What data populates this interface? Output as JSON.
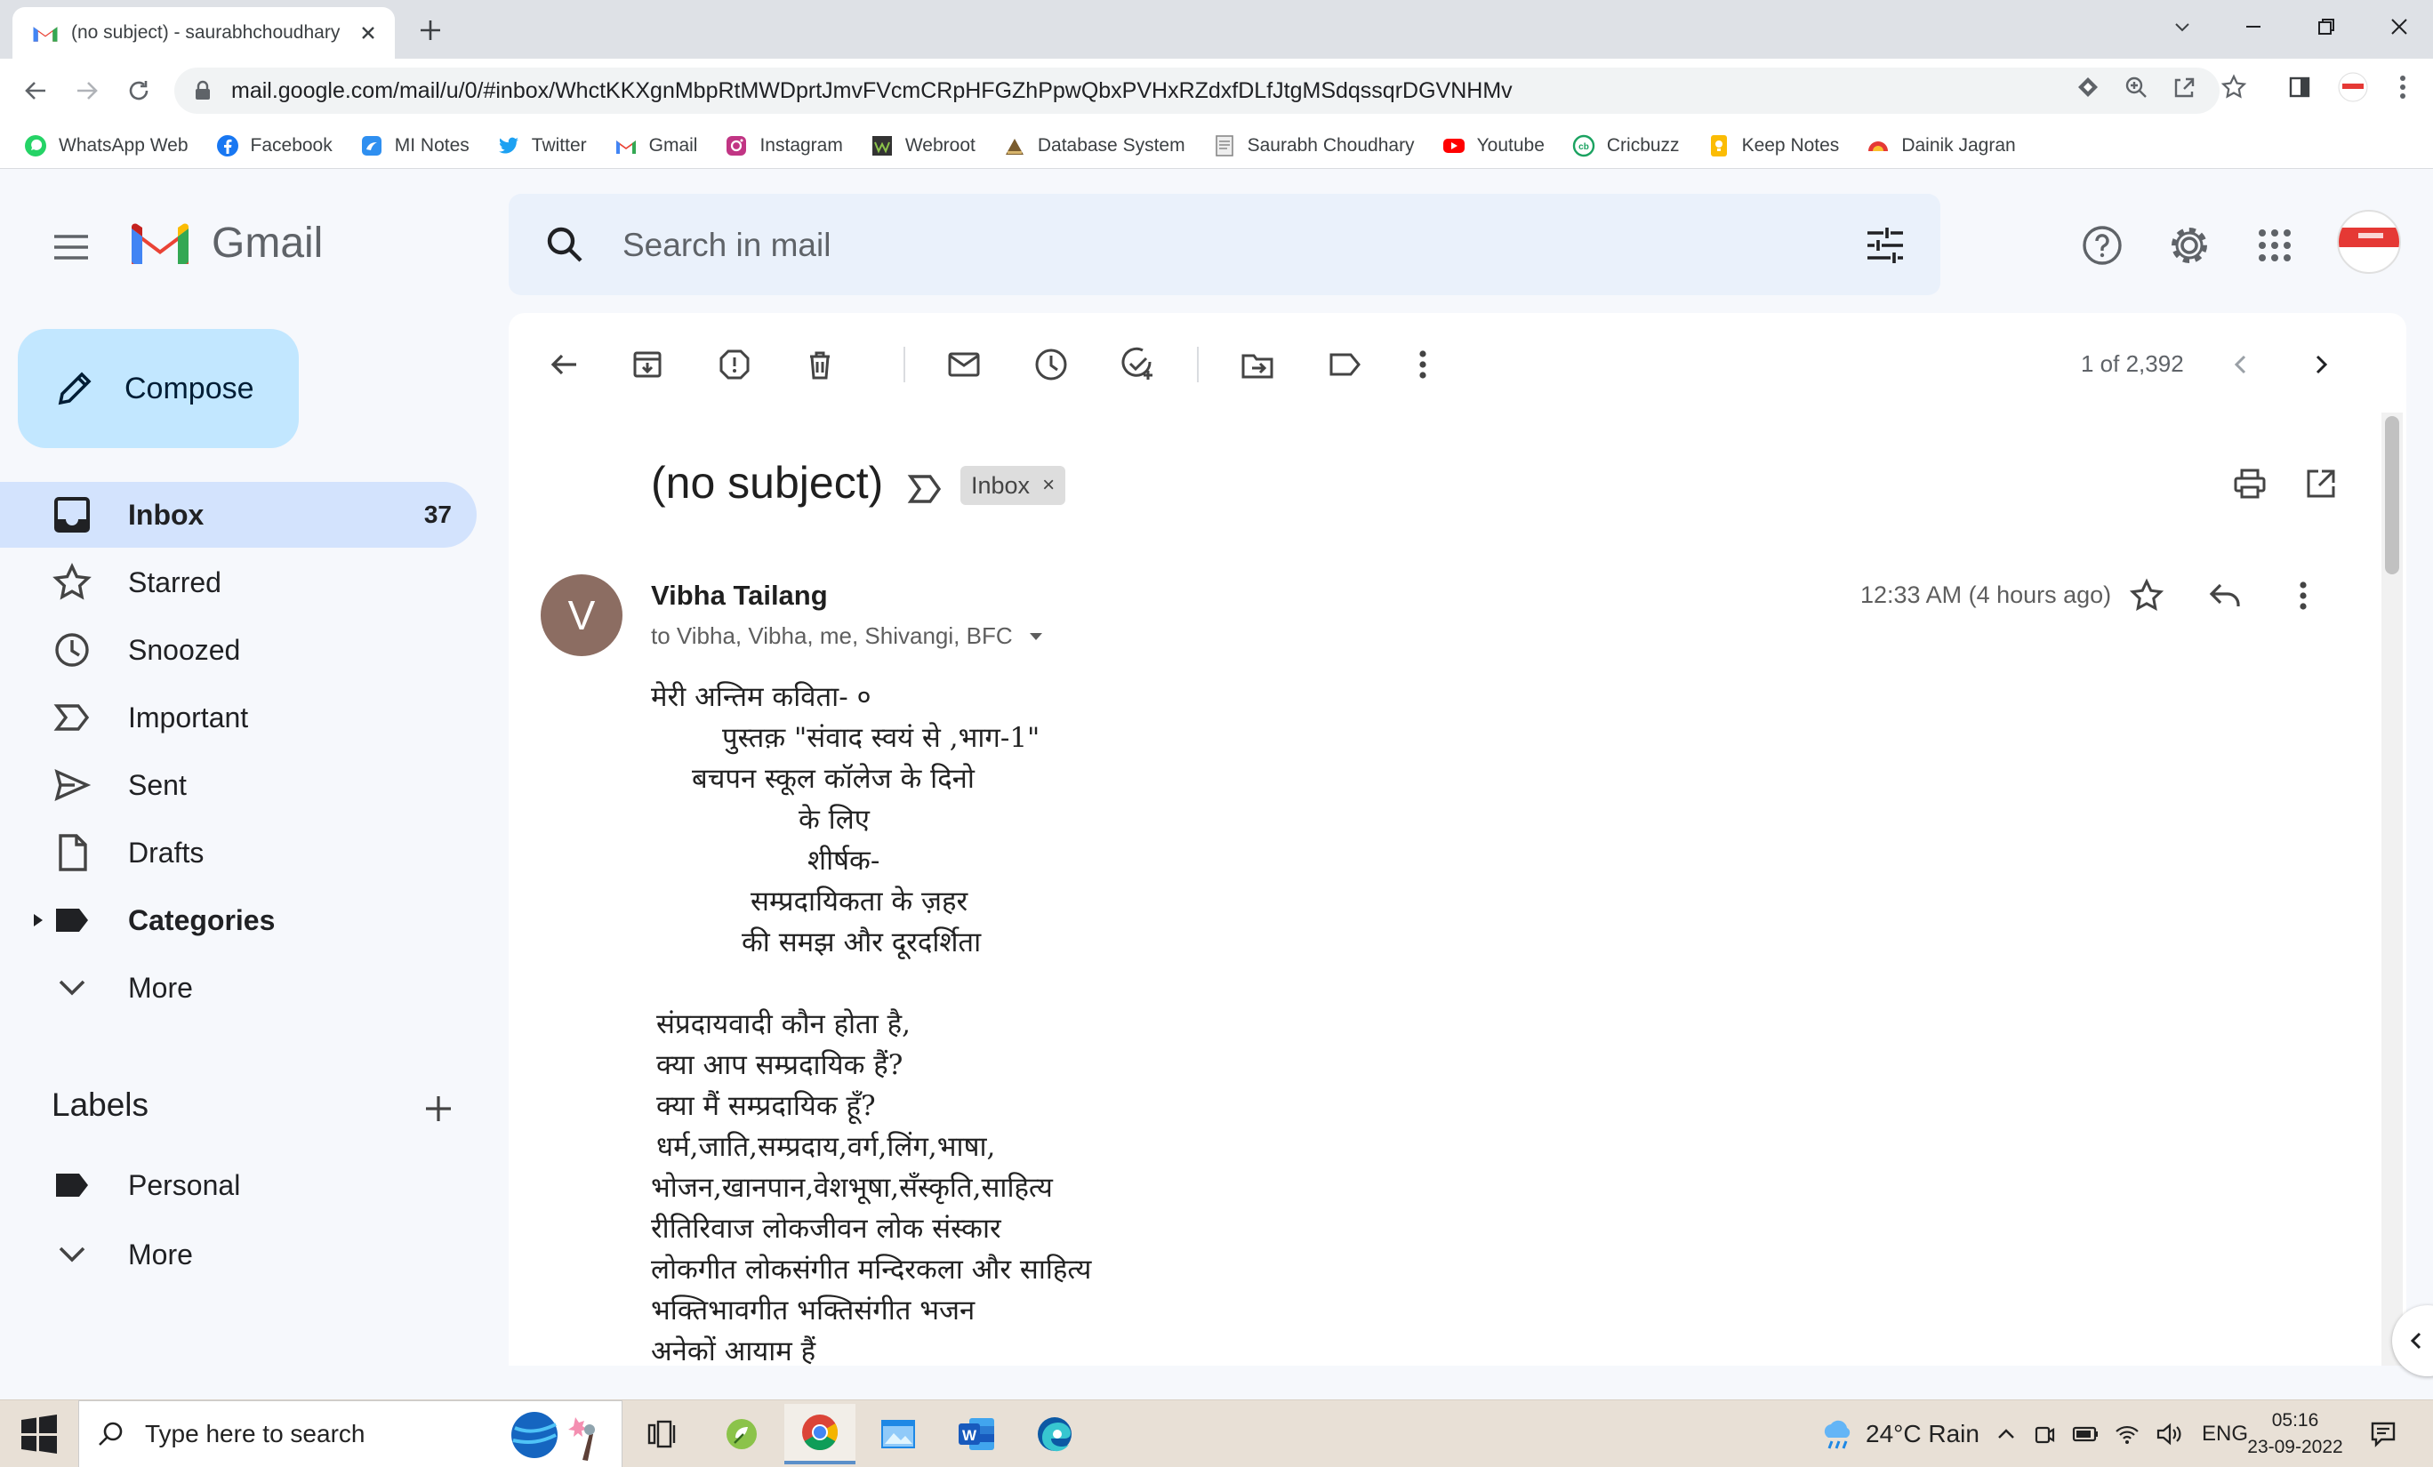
{
  "browser": {
    "tab_title": "(no subject) - saurabhchoudhary",
    "url": "mail.google.com/mail/u/0/#inbox/WhctKKXgnMbpRtMWDprtJmvFVcmCRpHFGZhPpwQbxPVHxRZdxfDLfJtgMSdqssqrDGVNHMv",
    "bookmarks": [
      {
        "label": "WhatsApp Web",
        "icon": "whatsapp-icon",
        "color": "#25d366"
      },
      {
        "label": "Facebook",
        "icon": "facebook-icon",
        "color": "#1877f2"
      },
      {
        "label": "MI Notes",
        "icon": "mi-notes-icon",
        "color": "#2f8ff0"
      },
      {
        "label": "Twitter",
        "icon": "twitter-icon",
        "color": "#1da1f2"
      },
      {
        "label": "Gmail",
        "icon": "gmail-icon",
        "color": "#ea4335"
      },
      {
        "label": "Instagram",
        "icon": "instagram-icon",
        "color": "#c13584"
      },
      {
        "label": "Webroot",
        "icon": "webroot-icon",
        "color": "#333333"
      },
      {
        "label": "Database System",
        "icon": "database-icon",
        "color": "#7a5c2e"
      },
      {
        "label": "Saurabh Choudhary",
        "icon": "document-icon",
        "color": "#888888"
      },
      {
        "label": "Youtube",
        "icon": "youtube-icon",
        "color": "#ff0000"
      },
      {
        "label": "Cricbuzz",
        "icon": "cricbuzz-icon",
        "color": "#1aa260"
      },
      {
        "label": "Keep Notes",
        "icon": "keep-icon",
        "color": "#fbbc04"
      },
      {
        "label": "Dainik Jagran",
        "icon": "jagran-icon",
        "color": "#e53935"
      }
    ]
  },
  "gmail": {
    "logo_text": "Gmail",
    "search_placeholder": "Search in mail",
    "compose_label": "Compose",
    "nav": [
      {
        "label": "Inbox",
        "count": "37",
        "icon": "inbox-icon"
      },
      {
        "label": "Starred",
        "count": "",
        "icon": "star-icon"
      },
      {
        "label": "Snoozed",
        "count": "",
        "icon": "clock-icon"
      },
      {
        "label": "Important",
        "count": "",
        "icon": "important-icon"
      },
      {
        "label": "Sent",
        "count": "",
        "icon": "send-icon"
      },
      {
        "label": "Drafts",
        "count": "",
        "icon": "draft-icon"
      },
      {
        "label": "Categories",
        "count": "",
        "icon": "label-icon"
      },
      {
        "label": "More",
        "count": "",
        "icon": "chevron-down-icon"
      }
    ],
    "labels_title": "Labels",
    "labels": [
      {
        "label": "Personal",
        "icon": "label-icon"
      },
      {
        "label": "More",
        "icon": "chevron-down-icon"
      }
    ]
  },
  "message": {
    "pager": "1 of 2,392",
    "subject": "(no subject)",
    "chip_label": "Inbox",
    "chip_close": "×",
    "sender_initial": "V",
    "sender_name": "Vibha Tailang",
    "recipients": "to Vibha, Vibha, me, Shivangi, BFC",
    "timestamp": "12:33 AM (4 hours ago)",
    "body_lines": [
      "मेरी अन्तिम कविता- ०",
      "पुस्तक़ \"संवाद स्वयं से ,भाग-1\"",
      "बचपन स्कूल कॉलेज के दिनो",
      "के लिए",
      "शीर्षक-",
      "सम्प्रदायिकता के ज़हर",
      "की समझ और दूरदर्शिता",
      "संप्रदायवादी कौन होता है,",
      "क्या आप सम्प्रदायिक हैं?",
      "क्या मैं सम्प्रदायिक हूँ?",
      "धर्म,जाति,सम्प्रदाय,वर्ग,लिंग,भाषा,",
      "भोजन,खानपान,वेशभूषा,सँस्कृति,साहित्य",
      "रीतिरिवाज लोकजीवन लोक संस्कार",
      "लोकगीत लोकसंगीत मन्दिरकला और साहित्य",
      "भक्तिभावगीत भक्तिसंगीत भजन",
      "अनेकों आयाम हैं"
    ]
  },
  "taskbar": {
    "search_placeholder": "Type here to search",
    "weather": "24°C  Rain",
    "language": "ENG",
    "time": "05:16",
    "date": "23-09-2022"
  }
}
